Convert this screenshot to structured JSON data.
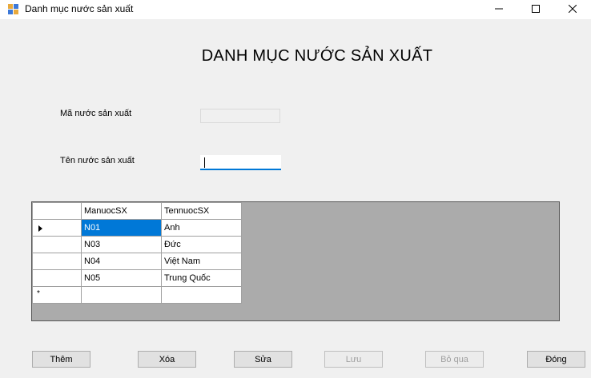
{
  "window": {
    "title": "Danh mục nước sản xuất"
  },
  "heading": "DANH MỤC NƯỚC SẢN XUẤT",
  "form": {
    "ma_label": "Mã nước sản xuất",
    "ma_value": "",
    "ten_label": "Tên nước sản xuất",
    "ten_value": ""
  },
  "grid": {
    "columns": [
      "ManuocSX",
      "TennuocSX"
    ],
    "rows": [
      {
        "ma": "N01",
        "ten": "Anh"
      },
      {
        "ma": "N03",
        "ten": "Đức"
      },
      {
        "ma": "N04",
        "ten": "Việt Nam"
      },
      {
        "ma": "N05",
        "ten": "Trung Quốc"
      }
    ],
    "new_row_marker": "*"
  },
  "buttons": {
    "them": "Thêm",
    "xoa": "Xóa",
    "sua": "Sửa",
    "luu": "Lưu",
    "boqua": "Bỏ qua",
    "dong": "Đóng"
  },
  "colors": {
    "selection": "#0078d7",
    "grid_background": "#ababab",
    "focus_border": "#0078d7"
  }
}
